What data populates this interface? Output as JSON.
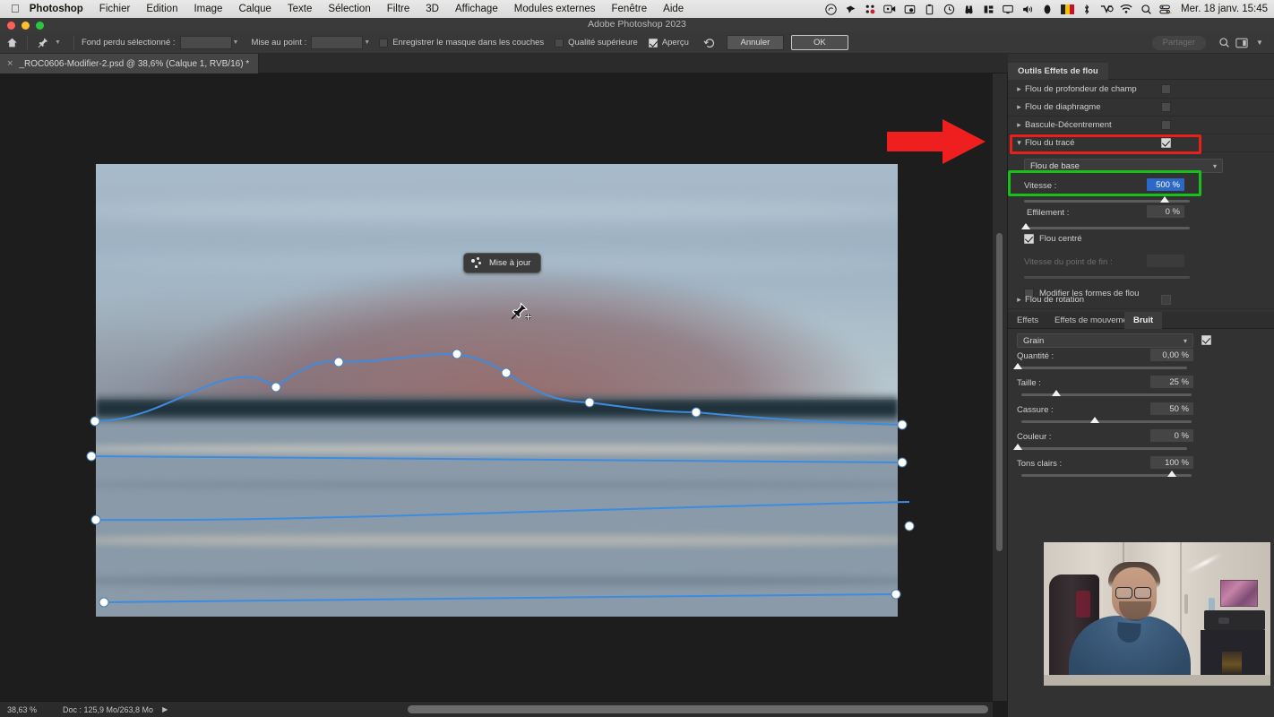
{
  "macos": {
    "apple_icon": "apple-logo-icon",
    "menus": [
      {
        "label": "Photoshop",
        "bold": true
      },
      {
        "label": "Fichier",
        "bold": false
      },
      {
        "label": "Edition",
        "bold": false
      },
      {
        "label": "Image",
        "bold": false
      },
      {
        "label": "Calque",
        "bold": false
      },
      {
        "label": "Texte",
        "bold": false
      },
      {
        "label": "Sélection",
        "bold": false
      },
      {
        "label": "Filtre",
        "bold": false
      },
      {
        "label": "3D",
        "bold": false
      },
      {
        "label": "Affichage",
        "bold": false
      },
      {
        "label": "Modules externes",
        "bold": false
      },
      {
        "label": "Fenêtre",
        "bold": false
      },
      {
        "label": "Aide",
        "bold": false
      }
    ],
    "status_icons": [
      "creative-cloud-icon",
      "bird-app-icon",
      "notification-badge-icon",
      "screen-record-icon",
      "screenshot-icon",
      "clipboard-icon",
      "time-machine-icon",
      "binoculars-icon",
      "columns-icon",
      "display-icon",
      "volume-icon",
      "avatar-icon",
      "belgium-flag-icon",
      "bluetooth-icon",
      "vpn-icon",
      "wifi-icon",
      "search-icon",
      "control-center-icon"
    ],
    "clock": "Mer. 18 janv.  15:45"
  },
  "window": {
    "app_title": "Adobe Photoshop 2023",
    "traffic_lights": [
      "close-button",
      "minimize-button",
      "zoom-button"
    ],
    "traffic_colors": [
      "#ff5f57",
      "#febc2e",
      "#28c840"
    ]
  },
  "options_bar": {
    "home_icon": "home-icon",
    "tool_icon": "pin-tool-icon",
    "field1_label": "Fond perdu sélectionné :",
    "field1_value": "",
    "field2_label": "Mise au point :",
    "field2_value": "",
    "check_mask_label": "Enregistrer le masque dans les couches",
    "check_mask_on": false,
    "check_quality_label": "Qualité supérieure",
    "check_quality_on": false,
    "check_preview_label": "Aperçu",
    "check_preview_on": true,
    "reset_icon": "reset-icon",
    "cancel_label": "Annuler",
    "ok_label": "OK",
    "share_label": "Partager",
    "search_icon": "search-icon",
    "workspace_icon": "workspace-icon",
    "workspace_caret_icon": "chevron-down-icon"
  },
  "document_tab": {
    "close_icon": "close-icon",
    "title": "_ROC0606-Modifier-2.psd @ 38,6% (Calque 1, RVB/16) *",
    "expand_icon": "expand-panels-icon"
  },
  "canvas": {
    "update_button_label": "Mise à jour",
    "update_icon": "loading-dots-icon",
    "cursor_icon": "pin-add-cursor-icon"
  },
  "status_bar": {
    "zoom": "38,63 %",
    "doc_info": "Doc : 125,9 Mo/263,8 Mo",
    "arrow_icon": "chevron-right-icon"
  },
  "right_panel": {
    "panel_title": "Outils Effets de flou",
    "blur_rows": [
      {
        "label": "Flou de profondeur de champ",
        "expanded": false,
        "checked": false,
        "chevron": "chevron-right-icon"
      },
      {
        "label": "Flou de diaphragme",
        "expanded": false,
        "checked": false,
        "chevron": "chevron-right-icon"
      },
      {
        "label": "Bascule-Décentrement",
        "expanded": false,
        "checked": false,
        "chevron": "chevron-right-icon"
      },
      {
        "label": "Flou du tracé",
        "expanded": true,
        "checked": true,
        "chevron": "chevron-down-icon"
      }
    ],
    "path_blur": {
      "mode_select": "Flou de base",
      "mode_caret": "chevron-down-icon",
      "speed_label": "Vitesse :",
      "speed_value": "500 %",
      "speed_percent": 100,
      "taper_label": "Effilement :",
      "taper_value": "0 %",
      "taper_percent": 0,
      "centered_label": "Flou centré",
      "centered_checked": true,
      "endpoint_label": "Vitesse du point de fin :",
      "endpoint_value": "",
      "endpoint_disabled": true,
      "edit_shapes_label": "Modifier les formes de flou",
      "edit_shapes_checked": false
    },
    "spin_blur": {
      "label": "Flou de rotation",
      "checked": false,
      "chevron": "chevron-right-icon"
    },
    "sub_tabs": [
      {
        "label": "Effets",
        "active": false
      },
      {
        "label": "Effets de mouvement",
        "active": false
      },
      {
        "label": "Bruit",
        "active": true
      }
    ],
    "noise": {
      "type_select": "Grain",
      "type_caret": "chevron-down-icon",
      "enabled": true,
      "sliders": [
        {
          "label": "Quantité :",
          "value": "0,00 %",
          "percent": 0
        },
        {
          "label": "Taille :",
          "value": "25 %",
          "percent": 25
        },
        {
          "label": "Cassure :",
          "value": "50 %",
          "percent": 50
        },
        {
          "label": "Couleur :",
          "value": "0 %",
          "percent": 0
        },
        {
          "label": "Tons clairs :",
          "value": "100 %",
          "percent": 100
        }
      ]
    }
  },
  "annotations": {
    "red_box_target": "Flou du tracé",
    "green_box_target": "Vitesse : 500 %",
    "arrow_icon": "red-arrow-right-icon",
    "red_color": "#e8201c",
    "green_color": "#16c21a"
  },
  "webcam": {
    "description": "webcam-overlay"
  }
}
